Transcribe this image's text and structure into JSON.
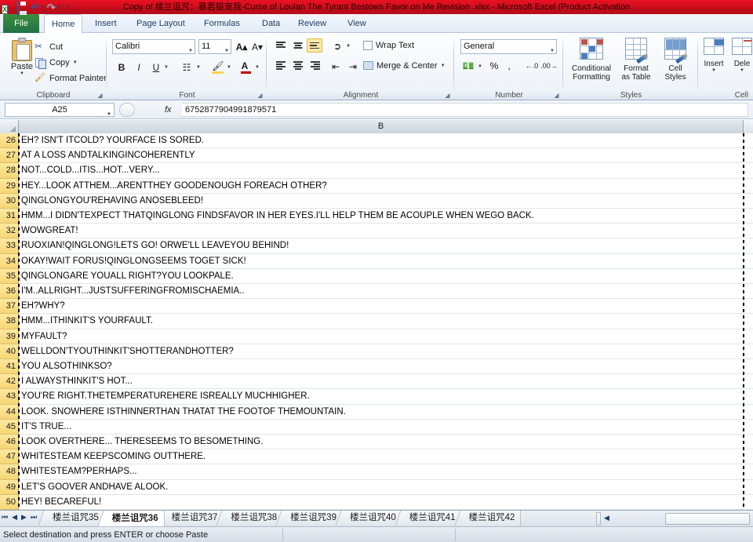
{
  "window": {
    "title": "Copy of 楼兰诅咒：暴君狠宠我-Curse of Loulan The Tyrant Bestows Favor on Me  Revision .xlsx  -  Microsoft Excel (Product Activation"
  },
  "quick_access": {
    "app_icon": "excel-icon",
    "items": [
      {
        "name": "save-icon",
        "label": "Save"
      },
      {
        "name": "undo-icon",
        "label": "Undo"
      },
      {
        "name": "redo-icon",
        "label": "Redo"
      },
      {
        "name": "customize-qat-icon",
        "label": "Customize Quick Access Toolbar"
      }
    ]
  },
  "ribbon": {
    "file_tab": "File",
    "tabs": [
      {
        "label": "Home",
        "active": true
      },
      {
        "label": "Insert",
        "active": false
      },
      {
        "label": "Page Layout",
        "active": false
      },
      {
        "label": "Formulas",
        "active": false
      },
      {
        "label": "Data",
        "active": false
      },
      {
        "label": "Review",
        "active": false
      },
      {
        "label": "View",
        "active": false
      }
    ],
    "groups": {
      "clipboard": {
        "label": "Clipboard",
        "paste": "Paste",
        "cut": "Cut",
        "copy": "Copy",
        "format_painter": "Format Painter"
      },
      "font": {
        "label": "Font",
        "font_name": "Calibri",
        "font_size": "11",
        "bold": "B",
        "italic": "I",
        "underline": "U"
      },
      "alignment": {
        "label": "Alignment",
        "wrap_text": "Wrap Text",
        "merge_center": "Merge & Center"
      },
      "number": {
        "label": "Number",
        "format": "General",
        "percent": "%",
        "comma": ","
      },
      "styles": {
        "label": "Styles",
        "conditional_formatting": "Conditional\nFormatting",
        "conditional_formatting_l1": "Conditional",
        "conditional_formatting_l2": "Formatting",
        "format_as_table_l1": "Format",
        "format_as_table_l2": "as Table",
        "cell_styles_l1": "Cell",
        "cell_styles_l2": "Styles"
      },
      "cells": {
        "label": "Cell",
        "insert": "Insert",
        "delete": "Dele"
      }
    }
  },
  "formula_bar": {
    "name_box": "A25",
    "fx_label": "fx",
    "formula": "6752877904991879571"
  },
  "grid": {
    "column_header": "B",
    "selected_column": "B",
    "rows": [
      {
        "num": "26",
        "text": "EH? ISN'T ITCOLD? YOURFACE IS SORED."
      },
      {
        "num": "27",
        "text": "AT A LOSS ANDTALKINGINCOHERENTLY"
      },
      {
        "num": "28",
        "text": "NOT...COLD...ITIS...HOT...VERY..."
      },
      {
        "num": "29",
        "text": "HEY...LOOK ATTHEM...ARENTTHEY GOODENOUGH FOREACH OTHER?"
      },
      {
        "num": "30",
        "text": "QINGLONGYOU'REHAVING ANOSEBLEED!"
      },
      {
        "num": "31",
        "text": "HMM...I DIDN'TEXPECT THATQINGLONG FINDSFAVOR IN HER EYES.I'LL HELP THEM BE ACOUPLE WHEN WEGO BACK."
      },
      {
        "num": "32",
        "text": "WOWGREAT!"
      },
      {
        "num": "33",
        "text": "RUOXIAN!QINGLONG!LETS GO! ORWE'LL LEAVEYOU BEHIND!"
      },
      {
        "num": "34",
        "text": "OKAY!WAIT FORUS!QINGLONGSEEMS TOGET SICK!"
      },
      {
        "num": "35",
        "text": "QINGLONGARE YOUALL RIGHT?YOU LOOKPALE."
      },
      {
        "num": "36",
        "text": "I'M..ALLRIGHT...JUSTSUFFERINGFROMISCHAEMIA.."
      },
      {
        "num": "37",
        "text": "EH?WHY?"
      },
      {
        "num": "38",
        "text": "HMM...ITHINKIT'S YOURFAULT."
      },
      {
        "num": "39",
        "text": "MYFAULT?"
      },
      {
        "num": "40",
        "text": "WELLDON'TYOUTHINKIT'SHOTTERANDHOTTER?"
      },
      {
        "num": "41",
        "text": "YOU ALSOTHINKSO?"
      },
      {
        "num": "42",
        "text": "I ALWAYSTHINKIT'S HOT..."
      },
      {
        "num": "43",
        "text": "YOU'RE RIGHT.THETEMPERATUREHERE ISREALLY MUCHHIGHER."
      },
      {
        "num": "44",
        "text": "LOOK. SNOWHERE ISTHINNERTHAN THATAT THE FOOTOF THEMOUNTAIN."
      },
      {
        "num": "45",
        "text": "IT'S TRUE..."
      },
      {
        "num": "46",
        "text": "LOOK OVERTHERE... THERESEEMS TO BESOMETHING."
      },
      {
        "num": "47",
        "text": "WHITESTEAM KEEPSCOMING OUTTHERE."
      },
      {
        "num": "48",
        "text": "WHITESTEAM?PERHAPS..."
      },
      {
        "num": "49",
        "text": "LET'S GOOVER ANDHAVE ALOOK."
      },
      {
        "num": "50",
        "text": "HEY! BECAREFUL!"
      }
    ]
  },
  "sheet_tabs": {
    "nav": [
      "first-sheet",
      "prev-sheet",
      "next-sheet",
      "last-sheet"
    ],
    "tabs": [
      {
        "label": "楼兰诅咒35",
        "active": false
      },
      {
        "label": "楼兰诅咒36",
        "active": true
      },
      {
        "label": "楼兰诅咒37",
        "active": false
      },
      {
        "label": "楼兰诅咒38",
        "active": false
      },
      {
        "label": "楼兰诅咒39",
        "active": false
      },
      {
        "label": "楼兰诅咒40",
        "active": false
      },
      {
        "label": "楼兰诅咒41",
        "active": false
      },
      {
        "label": "楼兰诅咒42",
        "active": false
      }
    ]
  },
  "status_bar": {
    "message": "Select destination and press ENTER or choose Paste"
  },
  "colors": {
    "title_bar": "#d40f1f",
    "file_tab": "#1e7145",
    "row_header_selected": "#f6d675",
    "accent": "#4a7ebb"
  }
}
